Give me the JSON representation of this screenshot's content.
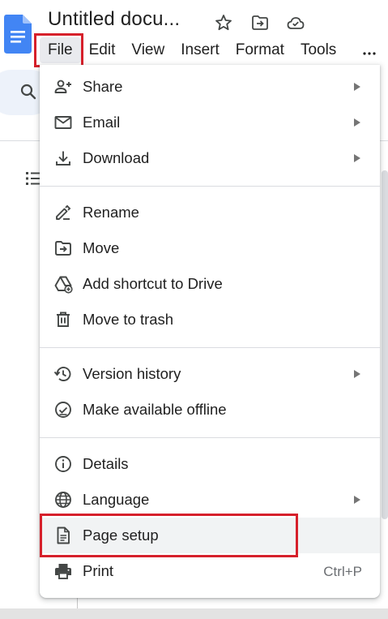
{
  "header": {
    "doc_title": "Untitled docu...",
    "icons": [
      "docs-logo-icon",
      "star-icon",
      "move-to-folder-icon",
      "cloud-saved-icon"
    ]
  },
  "menubar": {
    "items": [
      {
        "label": "File",
        "name": "menu-file"
      },
      {
        "label": "Edit",
        "name": "menu-edit"
      },
      {
        "label": "View",
        "name": "menu-view"
      },
      {
        "label": "Insert",
        "name": "menu-insert"
      },
      {
        "label": "Format",
        "name": "menu-format"
      },
      {
        "label": "Tools",
        "name": "menu-tools"
      }
    ],
    "overflow_icon": "more-horizontal-icon"
  },
  "file_menu": {
    "items": [
      {
        "label": "Share",
        "icon": "person-add-icon",
        "submenu": true
      },
      {
        "label": "Email",
        "icon": "mail-icon",
        "submenu": true
      },
      {
        "label": "Download",
        "icon": "download-icon",
        "submenu": true
      },
      {
        "label": "Rename",
        "icon": "rename-pencil-icon",
        "submenu": false
      },
      {
        "label": "Move",
        "icon": "move-folder-icon",
        "submenu": false
      },
      {
        "label": "Add shortcut to Drive",
        "icon": "drive-shortcut-icon",
        "submenu": false
      },
      {
        "label": "Move to trash",
        "icon": "trash-icon",
        "submenu": false
      },
      {
        "label": "Version history",
        "icon": "history-icon",
        "submenu": true
      },
      {
        "label": "Make available offline",
        "icon": "offline-check-icon",
        "submenu": false
      },
      {
        "label": "Details",
        "icon": "info-icon",
        "submenu": false
      },
      {
        "label": "Language",
        "icon": "globe-icon",
        "submenu": true
      },
      {
        "label": "Page setup",
        "icon": "page-setup-icon",
        "submenu": false,
        "highlighted": true
      },
      {
        "label": "Print",
        "icon": "printer-icon",
        "submenu": false,
        "shortcut": "Ctrl+P"
      }
    ]
  },
  "colors": {
    "highlight_outline": "#d6202b",
    "docs_blue": "#4285f4",
    "menu_text": "#1f1f1f",
    "icon_gray": "#444746",
    "hover_bg": "#f1f3f4"
  }
}
